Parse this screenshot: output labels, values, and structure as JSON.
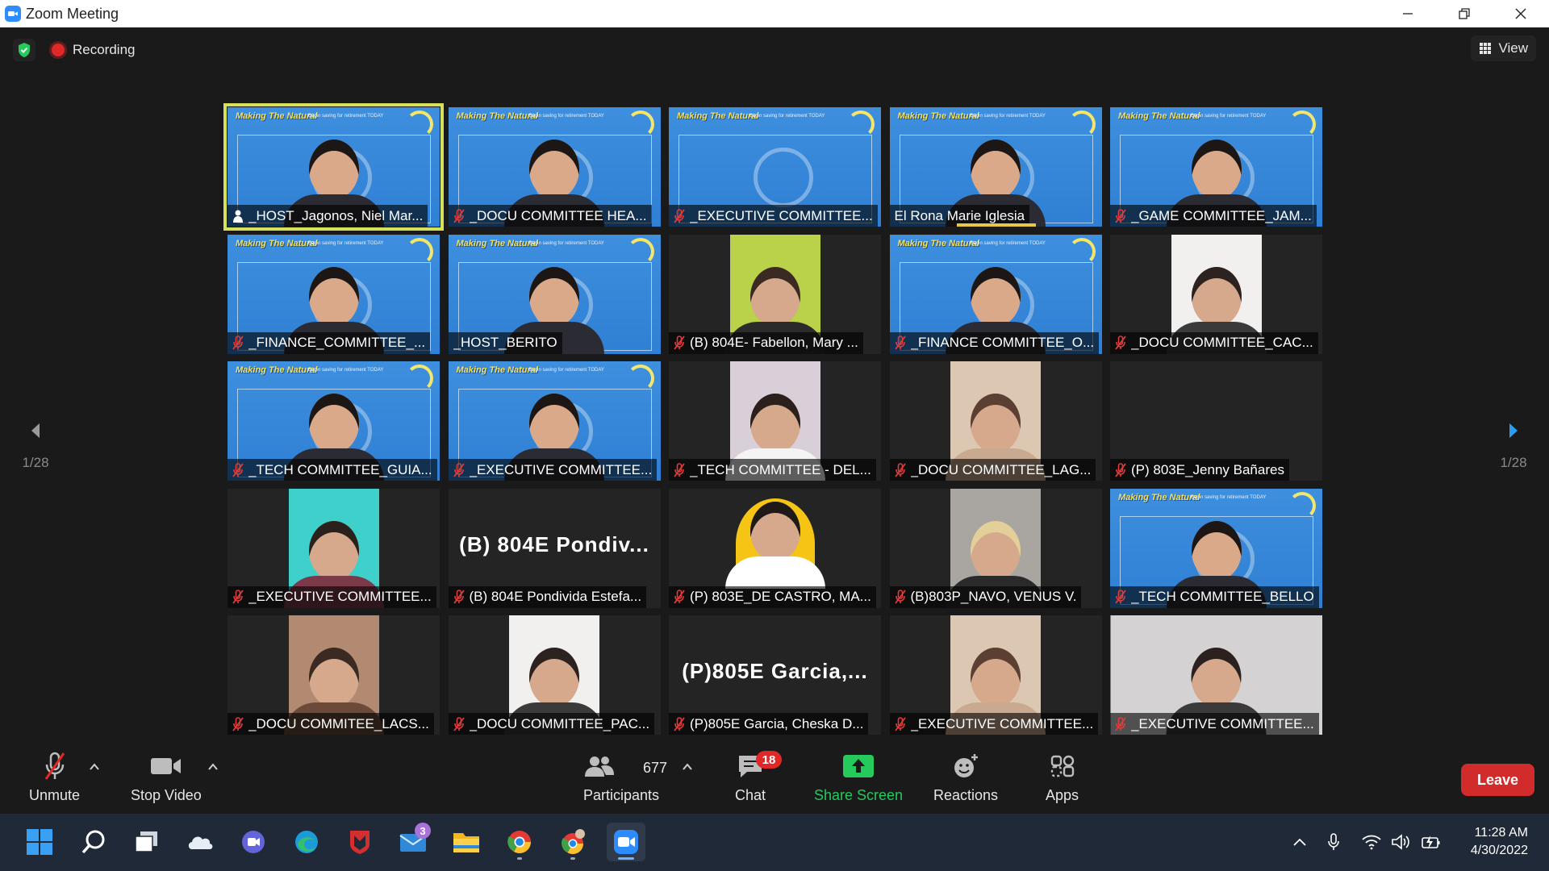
{
  "window": {
    "title": "Zoom Meeting"
  },
  "meeting": {
    "recording_label": "Recording",
    "view_label": "View",
    "page_left": "1/28",
    "page_right": "1/28"
  },
  "participants": [
    {
      "name": "_HOST_Jagonos, Niel Mar...",
      "video": "banner",
      "muted": false,
      "host": true,
      "active": true
    },
    {
      "name": "_DOCU COMMITTEE HEA...",
      "video": "banner",
      "muted": true
    },
    {
      "name": "_EXECUTIVE COMMITTEE...",
      "video": "banner",
      "muted": true
    },
    {
      "name": "El Rona Marie Iglesia",
      "video": "banner",
      "muted": false,
      "speaking": true
    },
    {
      "name": "_GAME COMMITTEE_JAM...",
      "video": "banner",
      "muted": true
    },
    {
      "name": "_FINANCE_COMMITTEE_...",
      "video": "banner",
      "muted": true
    },
    {
      "name": "_HOST_BERITO",
      "video": "banner",
      "muted": false
    },
    {
      "name": "(B) 804E- Fabellon, Mary ...",
      "video": "plain-green",
      "muted": true
    },
    {
      "name": "_FINANCE COMMITTEE_O...",
      "video": "banner",
      "muted": true
    },
    {
      "name": "_DOCU COMMITTEE_CAC...",
      "video": "plain-white",
      "muted": true
    },
    {
      "name": "_TECH COMMITTEE_GUIA...",
      "video": "banner",
      "muted": true
    },
    {
      "name": "_EXECUTIVE COMMITTEE...",
      "video": "banner",
      "muted": true
    },
    {
      "name": "_TECH COMMITTEE - DEL...",
      "video": "plain-pattern",
      "muted": true
    },
    {
      "name": "_DOCU COMMITTEE_LAG...",
      "video": "plain-beige",
      "muted": true
    },
    {
      "name": "(P) 803E_Jenny Bañares",
      "video": "off",
      "muted": true
    },
    {
      "name": "_EXECUTIVE COMMITTEE...",
      "video": "plain-teal",
      "muted": true
    },
    {
      "name": "(B) 804E Pondivida Estefa...",
      "video": "off",
      "muted": true,
      "display_name": "(B)  804E  Pondiv..."
    },
    {
      "name": "(P) 803E_DE CASTRO, MA...",
      "video": "plain-yellow",
      "muted": true
    },
    {
      "name": "(B)803P_NAVO, VENUS V.",
      "video": "plain-gray",
      "muted": true
    },
    {
      "name": "_TECH COMMITTEE_BELLO",
      "video": "banner",
      "muted": true
    },
    {
      "name": "_DOCU COMMITEE_LACS...",
      "video": "plain-skin",
      "muted": true
    },
    {
      "name": "_DOCU COMMITTEE_PAC...",
      "video": "plain-white",
      "muted": true
    },
    {
      "name": "(P)805E Garcia, Cheska D...",
      "video": "off",
      "muted": true,
      "display_name": "(P)805E  Garcia,..."
    },
    {
      "name": "_EXECUTIVE COMMITTEE...",
      "video": "plain-beige",
      "muted": true
    },
    {
      "name": "_EXECUTIVE COMMITTEE...",
      "video": "wide-gray",
      "muted": true
    }
  ],
  "banner": {
    "brand": "Making The Natural",
    "tag": "Begin saving for retirement TODAY"
  },
  "toolbar": {
    "unmute": "Unmute",
    "stop_video": "Stop Video",
    "participants": "Participants",
    "participant_count": "677",
    "chat": "Chat",
    "chat_badge": "18",
    "share_screen": "Share Screen",
    "reactions": "Reactions",
    "apps": "Apps",
    "leave": "Leave"
  },
  "taskbar": {
    "mail_badge": "3",
    "time": "11:28 AM",
    "date": "4/30/2022"
  },
  "colors": {
    "accent_green": "#25c95c",
    "leave_red": "#d22b2b",
    "active_border": "#d6e05a",
    "banner_blue": "#3e8fde"
  }
}
